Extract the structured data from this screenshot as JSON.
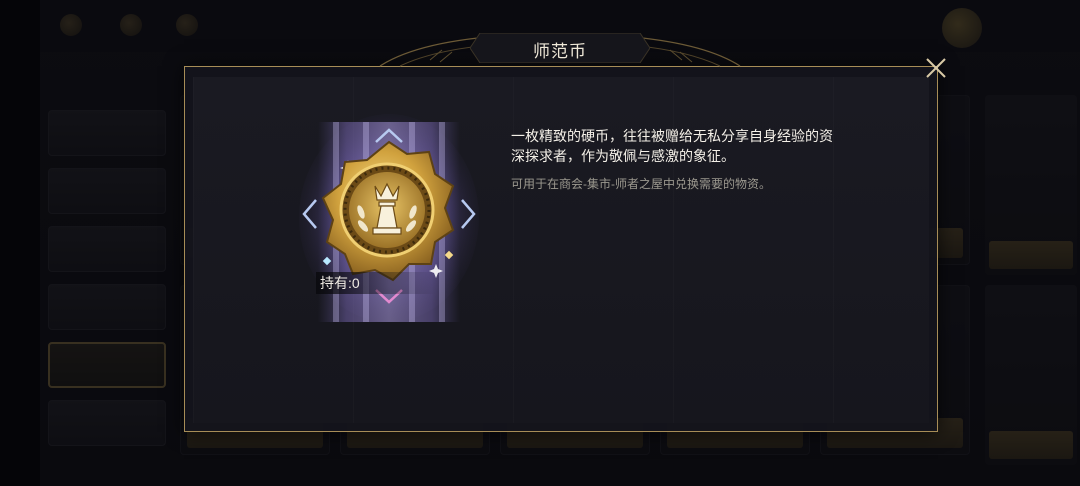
{
  "modal": {
    "title": "师范币",
    "item_name": "师范币",
    "holding_label": "持有:0",
    "description": "一枚精致的硬币，往往被赠给无私分享自身经验的资深探求者，作为敬佩与感激的象征。",
    "usage": "可用于在商会-集市-师者之屋中兑换需要的物资。"
  },
  "icons": {
    "close": "close-icon",
    "coin": "chess-king-coin-icon"
  },
  "colors": {
    "accent_gold": "#a78d57",
    "modal_bg": "#16161d",
    "text_primary": "#f4f0e8",
    "text_secondary": "#9c998f"
  }
}
